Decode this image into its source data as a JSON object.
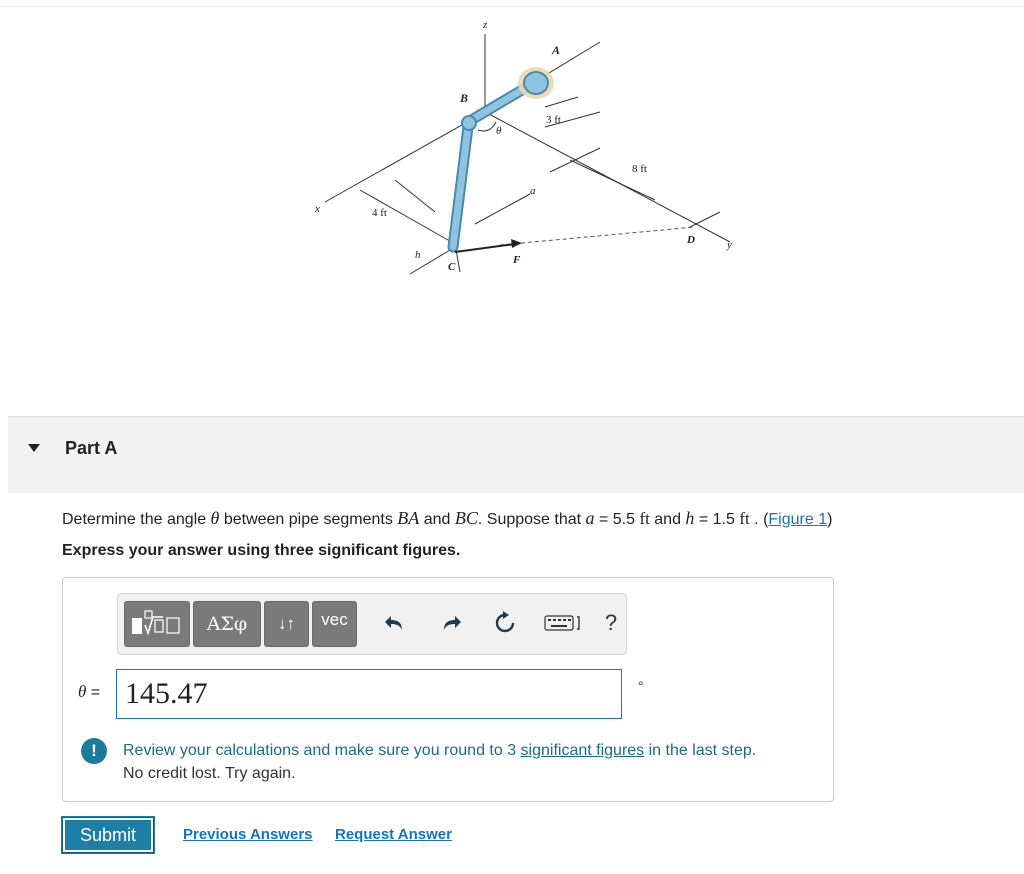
{
  "figure": {
    "labels": {
      "z": "z",
      "A": "A",
      "B": "B",
      "theta": "θ",
      "dim_3ft": "3 ft",
      "dim_8ft": "8 ft",
      "dim_4ft": "4 ft",
      "a": "a",
      "x": "x",
      "h": "h",
      "C": "C",
      "F": "F",
      "D": "D",
      "y": "y"
    }
  },
  "part": {
    "title": "Part A"
  },
  "question": {
    "p1": "Determine the angle ",
    "theta": "θ",
    "p2": " between pipe segments ",
    "BA": "BA",
    "p3": " and ",
    "BC": "BC",
    "p4": ". Suppose that ",
    "a": "a",
    "p5": " = 5.5 ",
    "ft1": "ft",
    "p6": " and ",
    "h": "h",
    "p7": " = 1.5 ",
    "ft2": "ft",
    "p8": " . (",
    "figure_link": "Figure 1",
    "p9": ")"
  },
  "instruction": "Express your answer using three significant figures.",
  "toolbar": {
    "greek": "ΑΣφ",
    "arrows": "↓↑",
    "vec": "vec",
    "help": "?",
    "colors": {
      "button": "#7a7a7a",
      "bar": "#f1f1f1"
    }
  },
  "answer": {
    "var": "θ",
    "eq": " =",
    "value": "145.47",
    "unit": "°"
  },
  "feedback": {
    "icon": "!",
    "l1a": "Review your calculations and make sure you round to 3 ",
    "l1link": "significant figures",
    "l1b": " in the last step.",
    "l2": "No credit lost. Try again.",
    "color": "#1c7a9c"
  },
  "buttons": {
    "submit": "Submit",
    "previous": "Previous Answers",
    "request": "Request Answer"
  },
  "colors": {
    "accent": "#1f7ea3",
    "link": "#1a73b5",
    "pipe": "#8ec4e0"
  }
}
